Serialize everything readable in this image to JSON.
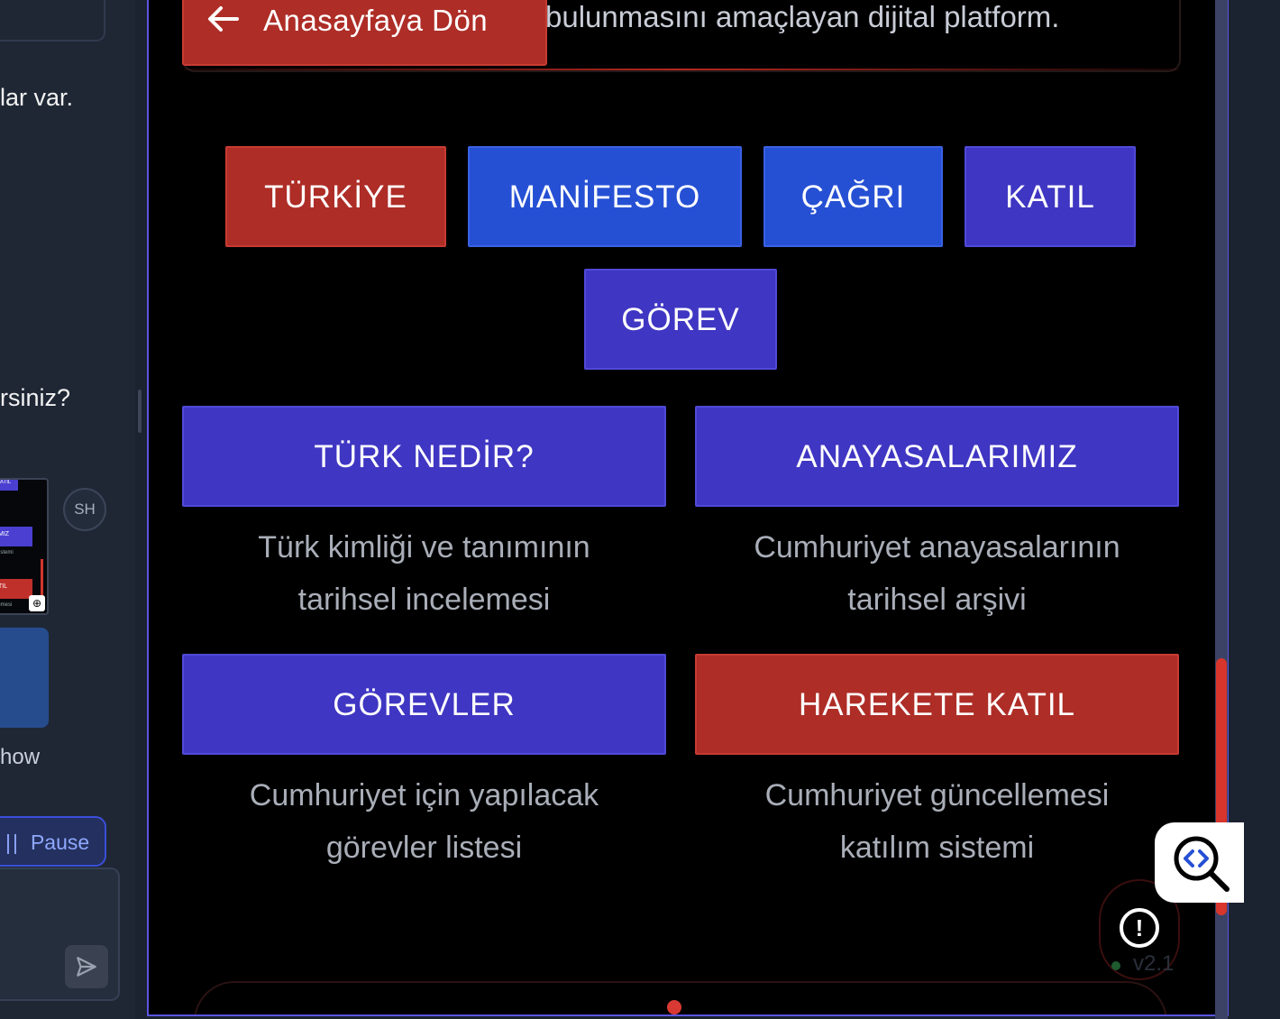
{
  "sidebar": {
    "msg_fragment_1": "lar var.",
    "msg_fragment_2": "rsiniz?",
    "avatar_initials": "SH",
    "show_fragment": "how",
    "pause_label": "Pause",
    "thumb_labels": [
      "KATIL",
      "MIZ",
      "sistemi",
      "TIL",
      "lemesi"
    ]
  },
  "preview": {
    "back_button_label": "Anasayfaya Dön",
    "intro_text": "bulunmasını amaçlayan dijital platform.",
    "nav": [
      "TÜRKİYE",
      "MANİFESTO",
      "ÇAĞRI",
      "KATIL",
      "GÖREV"
    ],
    "cards": [
      {
        "title": "TÜRK NEDİR?",
        "desc_line1": "Türk kimliği ve tanımının",
        "desc_line2": "tarihsel incelemesi"
      },
      {
        "title": "ANAYASALARIMIZ",
        "desc_line1": "Cumhuriyet anayasalarının",
        "desc_line2": "tarihsel arşivi"
      },
      {
        "title": "GÖREVLER",
        "desc_line1": "Cumhuriyet için yapılacak",
        "desc_line2": "görevler listesi"
      },
      {
        "title": "HAREKETE KATIL",
        "desc_line1": "Cumhuriyet güncellemesi",
        "desc_line2": "katılım sistemi"
      }
    ],
    "alert_symbol": "!",
    "version": "v2.1"
  },
  "colors": {
    "red": "#ae2d27",
    "blue": "#2650d4",
    "indigo": "#3f36c3",
    "background": "#000000",
    "frame_border": "#5b55e0"
  },
  "icons": [
    "arrow-left-icon",
    "send-icon",
    "pause-icon",
    "code-search-icon",
    "alert-icon",
    "zoom-icon"
  ]
}
